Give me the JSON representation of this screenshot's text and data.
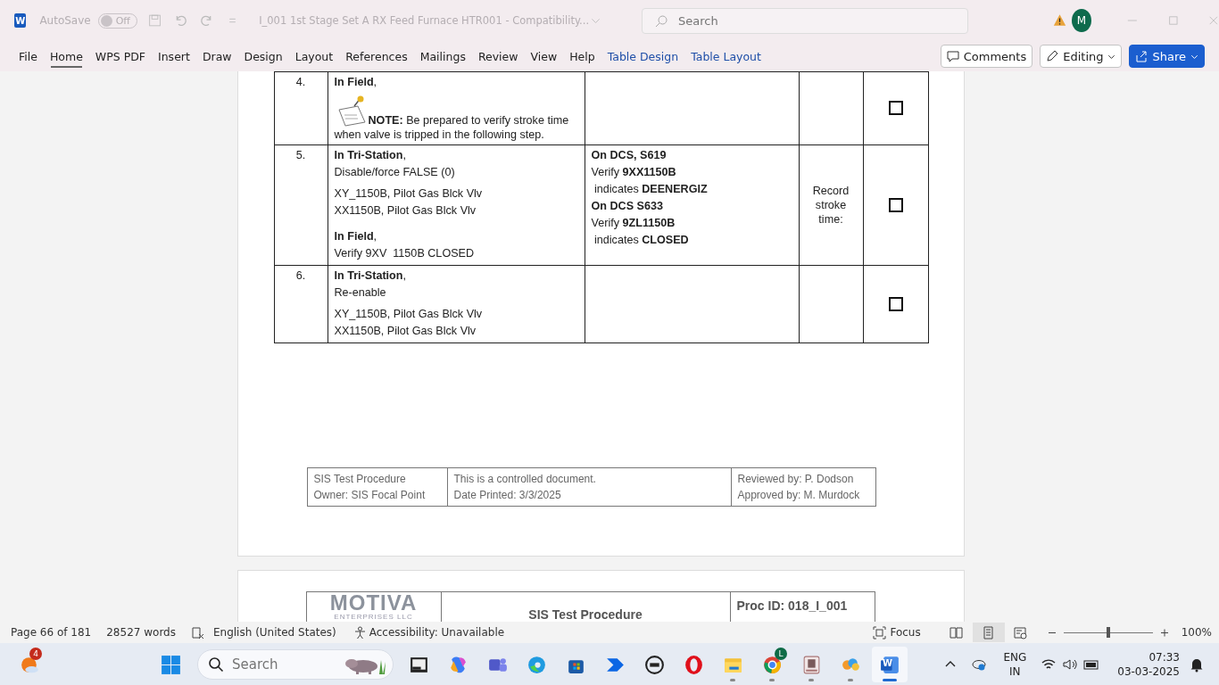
{
  "title_bar": {
    "app_icon": "W",
    "autosave_label": "AutoSave",
    "autosave": {
      "label": "Off",
      "on": false
    },
    "document_title": "I_001 1st Stage Set A RX Feed Furnace HTR001  -  Compatibility...",
    "search": {
      "placeholder": "Search"
    },
    "avatar": "M"
  },
  "ribbon": {
    "tabs": [
      {
        "label": "File",
        "selected": false,
        "kind": "plain"
      },
      {
        "label": "Home",
        "selected": true,
        "kind": "plain"
      },
      {
        "label": "WPS PDF",
        "selected": false,
        "kind": "plain"
      },
      {
        "label": "Insert",
        "selected": false,
        "kind": "plain"
      },
      {
        "label": "Draw",
        "selected": false,
        "kind": "plain"
      },
      {
        "label": "Design",
        "selected": false,
        "kind": "plain"
      },
      {
        "label": "Layout",
        "selected": false,
        "kind": "plain"
      },
      {
        "label": "References",
        "selected": false,
        "kind": "plain"
      },
      {
        "label": "Mailings",
        "selected": false,
        "kind": "plain"
      },
      {
        "label": "Review",
        "selected": false,
        "kind": "plain"
      },
      {
        "label": "View",
        "selected": false,
        "kind": "plain"
      },
      {
        "label": "Help",
        "selected": false,
        "kind": "plain"
      },
      {
        "label": "Table Design",
        "selected": false,
        "kind": "contextual"
      },
      {
        "label": "Table Layout",
        "selected": false,
        "kind": "contextual"
      }
    ],
    "buttons": [
      {
        "label": "Comments",
        "kind": "comments"
      },
      {
        "label": "Editing",
        "kind": "editing"
      },
      {
        "label": "Share",
        "kind": "share"
      }
    ]
  },
  "document": {
    "steps": [
      {
        "number": "4.",
        "instruction": [
          {
            "kind": "text",
            "lines": [
              "**In Field**,"
            ]
          },
          {
            "kind": "note",
            "lines": [
              "**NOTE:** Be prepared to verify stroke time when valve is tripped in the following step."
            ]
          }
        ],
        "checked": false
      },
      {
        "number": "5.",
        "instruction": [
          {
            "kind": "text",
            "lines": [
              "**In Tri-Station**,",
              "Disable/force FALSE (0)"
            ]
          },
          {
            "kind": "text",
            "lines": [
              "XY_1150B, Pilot Gas Blck Vlv",
              "XX1150B, Pilot Gas Blck Vlv"
            ]
          },
          {
            "kind": "text",
            "lines": [
              "**In Field**,",
              "Verify 9XV  1150B CLOSED"
            ]
          }
        ],
        "verification": [
          "**On DCS, S619**",
          "Verify **9XX1150B**",
          " indicates **DEENERGIZ**",
          "**On DCS S633**",
          "Verify **9ZL1150B**",
          " indicates **CLOSED**"
        ],
        "record": "Record stroke time:",
        "checked": false
      },
      {
        "number": "6.",
        "instruction": [
          {
            "kind": "text",
            "lines": [
              "**In Tri-Station**,",
              "Re-enable"
            ]
          },
          {
            "kind": "text",
            "lines": [
              "XY_1150B, Pilot Gas Blck Vlv",
              "XX1150B, Pilot Gas Blck Vlv"
            ]
          }
        ],
        "checked": false
      }
    ],
    "footer": {
      "left": [
        "SIS Test Procedure",
        "Owner: SIS Focal Point"
      ],
      "center": [
        "This is a controlled document.",
        "Date Printed: 3/3/2025"
      ],
      "right": [
        "Reviewed by: P. Dodson",
        "Approved by: M. Murdock"
      ]
    },
    "next_page_header": {
      "logo": "MOTIVA",
      "logo_subtitle": "ENTERPRISES LLC",
      "title": "SIS Test Procedure",
      "proc_id": "Proc ID: 018_I_001"
    }
  },
  "status_bar": {
    "page": "Page 66 of 181",
    "words": "28527 words",
    "language": "English (United States)",
    "accessibility": "Accessibility: Unavailable",
    "focus": "Focus",
    "views": [
      {
        "kind": "read",
        "selected": false
      },
      {
        "kind": "print",
        "selected": true
      },
      {
        "kind": "web",
        "selected": false
      }
    ],
    "zoom": {
      "level": 0.5,
      "reading": "100%"
    }
  },
  "taskbar": {
    "weather_badge": "4",
    "search": {
      "placeholder": "Search"
    },
    "apps": [
      {
        "kind": "terminal",
        "running": false,
        "selected": false
      },
      {
        "kind": "copilot",
        "running": false,
        "selected": false
      },
      {
        "kind": "teams",
        "running": false,
        "selected": false
      },
      {
        "kind": "edge",
        "running": false,
        "selected": false
      },
      {
        "kind": "store",
        "running": false,
        "selected": false
      },
      {
        "kind": "automate",
        "running": false,
        "selected": false
      },
      {
        "kind": "dell",
        "running": false,
        "selected": false
      },
      {
        "kind": "opera",
        "running": false,
        "selected": false
      },
      {
        "kind": "explorer",
        "running": true,
        "selected": false
      },
      {
        "kind": "chrome",
        "running": true,
        "selected": false,
        "badge": "L"
      },
      {
        "kind": "photo",
        "running": true,
        "selected": false
      },
      {
        "kind": "puzzle",
        "running": true,
        "selected": false
      },
      {
        "kind": "word",
        "running": true,
        "selected": true,
        "letter": "W"
      }
    ],
    "language": [
      "ENG",
      "IN"
    ],
    "time": "07:33",
    "date": "03-03-2025"
  }
}
